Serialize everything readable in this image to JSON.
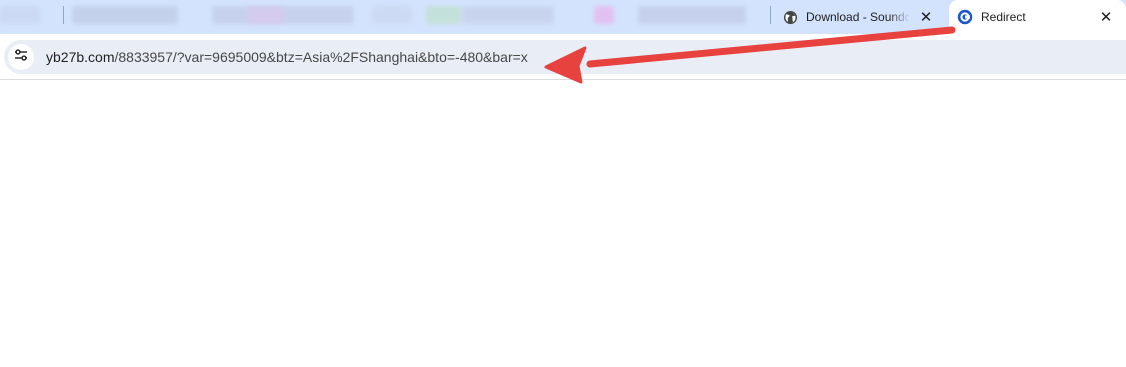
{
  "browser": {
    "tabs": [
      {
        "title": "Download - Soundc",
        "icon": "globe-icon",
        "active": false,
        "close_glyph": "✕"
      },
      {
        "title": "Redirect",
        "icon": "redirect-c-icon",
        "active": true,
        "close_glyph": "✕"
      }
    ],
    "omnibox": {
      "host": "yb27b.com",
      "path": "/8833957/?var=9695009&btz=Asia%2FShanghai&bto=-480&bar=x",
      "site_info_icon": "tune-icon"
    }
  },
  "annotation": {
    "type": "arrow",
    "color": "#e8423f",
    "points_to": "omnibox-url"
  },
  "colors": {
    "tabstrip_bg": "#d3e3fd",
    "omnibox_bg": "#e9eef6",
    "redirect_icon": "#1a56c5"
  }
}
